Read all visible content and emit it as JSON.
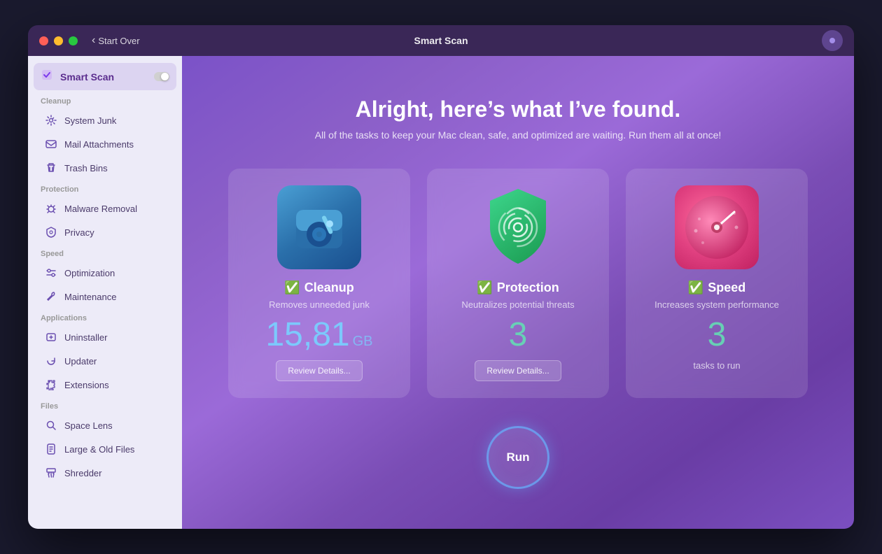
{
  "window": {
    "title": "Smart Scan",
    "back_label": "Start Over"
  },
  "sidebar": {
    "active_item": {
      "label": "Smart Scan",
      "icon": "scan"
    },
    "sections": [
      {
        "label": "Cleanup",
        "items": [
          {
            "id": "system-junk",
            "label": "System Junk",
            "icon": "gear"
          },
          {
            "id": "mail-attachments",
            "label": "Mail Attachments",
            "icon": "mail"
          },
          {
            "id": "trash-bins",
            "label": "Trash Bins",
            "icon": "trash"
          }
        ]
      },
      {
        "label": "Protection",
        "items": [
          {
            "id": "malware-removal",
            "label": "Malware Removal",
            "icon": "bug"
          },
          {
            "id": "privacy",
            "label": "Privacy",
            "icon": "hand"
          }
        ]
      },
      {
        "label": "Speed",
        "items": [
          {
            "id": "optimization",
            "label": "Optimization",
            "icon": "sliders"
          },
          {
            "id": "maintenance",
            "label": "Maintenance",
            "icon": "wrench"
          }
        ]
      },
      {
        "label": "Applications",
        "items": [
          {
            "id": "uninstaller",
            "label": "Uninstaller",
            "icon": "uninstall"
          },
          {
            "id": "updater",
            "label": "Updater",
            "icon": "update"
          },
          {
            "id": "extensions",
            "label": "Extensions",
            "icon": "puzzle"
          }
        ]
      },
      {
        "label": "Files",
        "items": [
          {
            "id": "space-lens",
            "label": "Space Lens",
            "icon": "lens"
          },
          {
            "id": "large-old-files",
            "label": "Large & Old Files",
            "icon": "file"
          },
          {
            "id": "shredder",
            "label": "Shredder",
            "icon": "shred"
          }
        ]
      }
    ]
  },
  "main": {
    "heading": "Alright, here’s what I’ve found.",
    "subheading": "All of the tasks to keep your Mac clean, safe, and optimized are waiting. Run them all at once!",
    "cards": [
      {
        "id": "cleanup",
        "title": "Cleanup",
        "desc": "Removes unneeded junk",
        "number": "15,81",
        "unit": "GB",
        "has_review": true,
        "review_label": "Review Details..."
      },
      {
        "id": "protection",
        "title": "Protection",
        "desc": "Neutralizes potential threats",
        "number": "3",
        "unit": "",
        "has_review": true,
        "review_label": "Review Details..."
      },
      {
        "id": "speed",
        "title": "Speed",
        "desc": "Increases system performance",
        "number": "3",
        "unit": "",
        "has_review": false,
        "tasks_label": "tasks to run"
      }
    ],
    "run_button_label": "Run"
  }
}
